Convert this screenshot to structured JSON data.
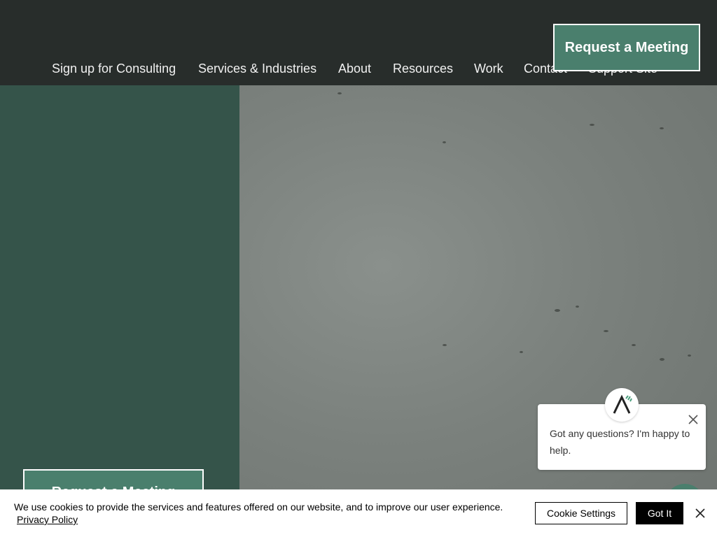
{
  "header": {
    "nav": [
      {
        "label": "Sign up for Consulting"
      },
      {
        "label": "Services & Industries"
      },
      {
        "label": "About"
      },
      {
        "label": "Resources"
      },
      {
        "label": "Work"
      },
      {
        "label": "Contact"
      },
      {
        "label": "Support Site"
      }
    ],
    "cta_label": "Request a Meeting"
  },
  "left_panel": {
    "cta_label": "Request a Meeting"
  },
  "chat": {
    "message": "Got any questions? I'm happy to help."
  },
  "cookie_banner": {
    "text": "We use cookies to provide the services and features offered on our website, and to improve our user experience.",
    "privacy_link": "Privacy Policy",
    "settings_label": "Cookie Settings",
    "accept_label": "Got It"
  },
  "colors": {
    "header_bg": "#282d2b",
    "brand_green": "#4a7f6d",
    "panel_green": "#35544a"
  }
}
